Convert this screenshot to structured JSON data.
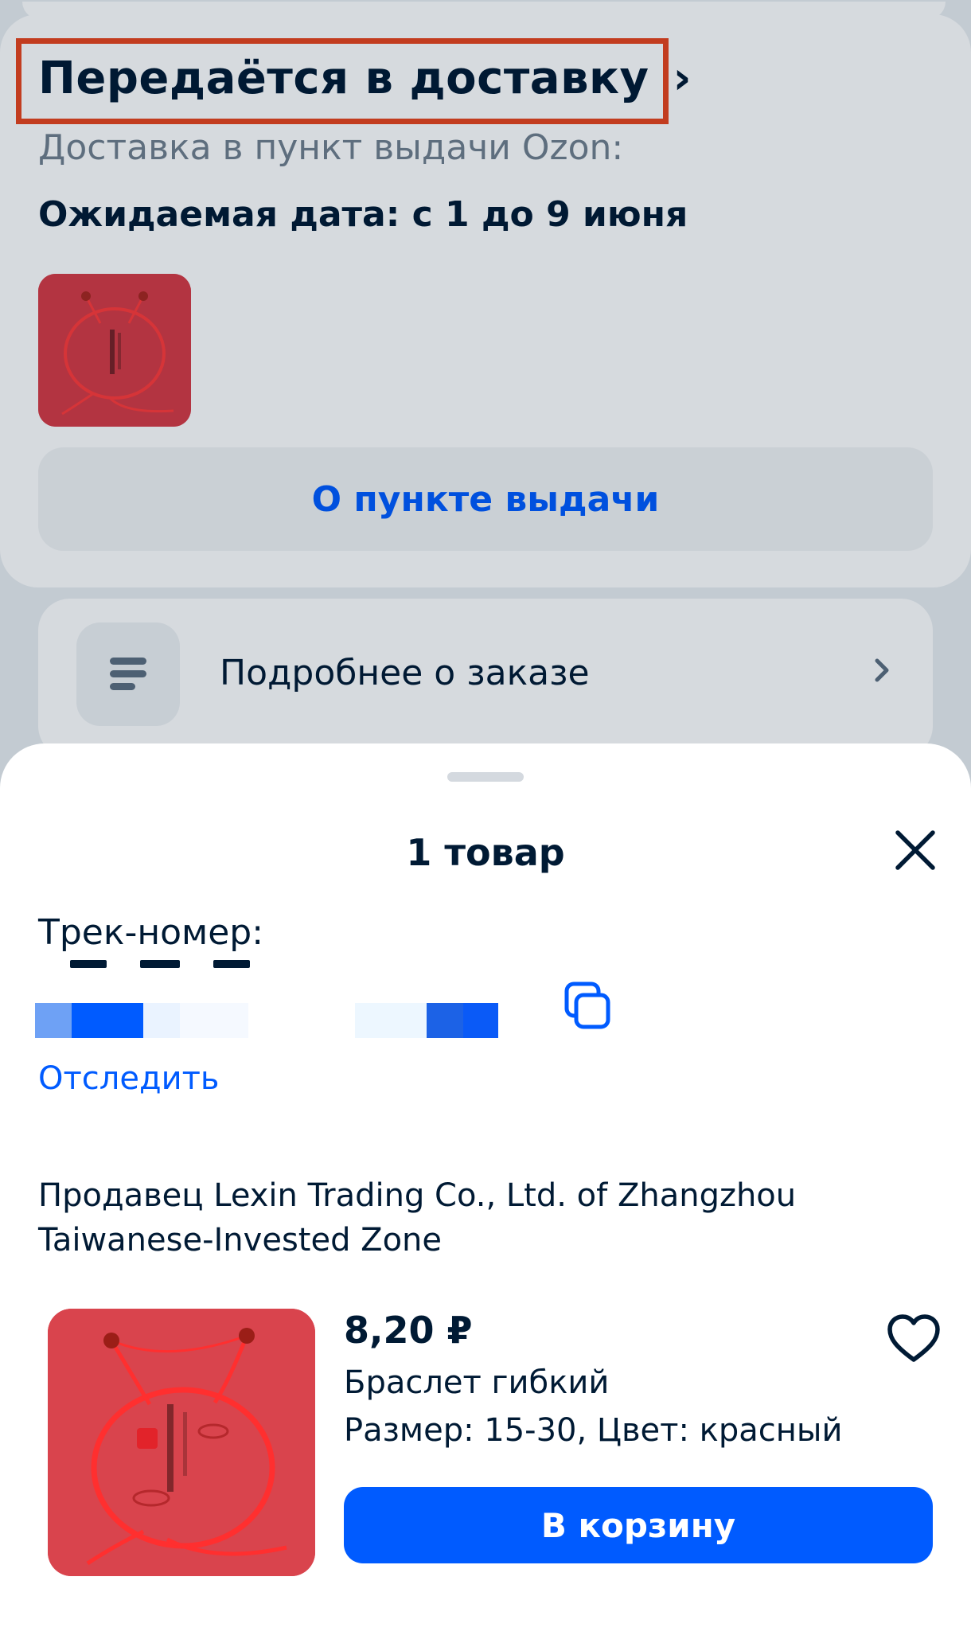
{
  "order_card": {
    "status_title": "Передаётся в доставку",
    "status_chevron": "›",
    "delivery_type": "Доставка в пункт выдачи Ozon:",
    "expected_date": "Ожидаемая дата: с 1 до 9 июня",
    "pickup_button": "О пункте выдачи",
    "highlight_color": "#e8431c"
  },
  "details_row": {
    "label": "Подробнее о заказе",
    "icon": "list-icon",
    "chevron_icon": "chevron-right-icon"
  },
  "sheet": {
    "title": "1 товар",
    "close_icon": "close-icon",
    "track_label": "Трек-номер:",
    "copy_icon": "copy-icon",
    "track_link": "Отследить",
    "seller": "Продавец Lexin Trading Co., Ltd. of Zhangzhou Taiwanese-Invested Zone"
  },
  "product": {
    "price": "8,20 ₽",
    "name": "Браслет гибкий",
    "attributes": "Размер: 15-30, Цвет: красный",
    "favorite_icon": "heart-icon",
    "cart_button": "В корзину"
  },
  "colors": {
    "accent": "#005bff",
    "text": "#001a34",
    "muted": "#707f8d"
  }
}
